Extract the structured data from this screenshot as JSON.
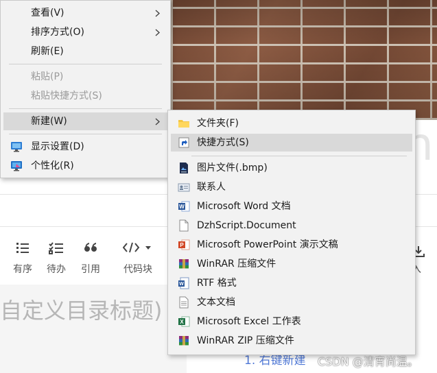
{
  "main_menu": {
    "items": [
      {
        "label": "查看(V)"
      },
      {
        "label": "排序方式(O)"
      },
      {
        "label": "刷新(E)"
      },
      {
        "label": "粘贴(P)"
      },
      {
        "label": "粘贴快捷方式(S)"
      },
      {
        "label": "新建(W)"
      },
      {
        "label": "显示设置(D)",
        "icon": "display-settings-icon"
      },
      {
        "label": "个性化(R)",
        "icon": "personalize-icon"
      }
    ]
  },
  "new_submenu": {
    "items": [
      {
        "label": "文件夹(F)",
        "icon": "folder-icon"
      },
      {
        "label": "快捷方式(S)",
        "icon": "shortcut-icon"
      },
      {
        "label": "图片文件(.bmp)",
        "icon": "bmp-image-icon"
      },
      {
        "label": "联系人",
        "icon": "contact-card-icon"
      },
      {
        "label": "Microsoft Word 文档",
        "icon": "word-icon"
      },
      {
        "label": "DzhScript.Document",
        "icon": "blank-document-icon"
      },
      {
        "label": "Microsoft PowerPoint 演示文稿",
        "icon": "powerpoint-icon"
      },
      {
        "label": "WinRAR 压缩文件",
        "icon": "winrar-icon"
      },
      {
        "label": "RTF 格式",
        "icon": "rtf-icon"
      },
      {
        "label": "文本文档",
        "icon": "text-document-icon"
      },
      {
        "label": "Microsoft Excel 工作表",
        "icon": "excel-icon"
      },
      {
        "label": "WinRAR ZIP 压缩文件",
        "icon": "winrar-zip-icon"
      }
    ]
  },
  "editor": {
    "bg_char": "n",
    "toolbar": {
      "ordered_label": "有序",
      "todo_label": "待办",
      "quote_label": "引用",
      "code_label": "代码块",
      "import_tail": "入"
    },
    "heading_placeholder": "自定义目录标题)",
    "list_line": "1. 右键新建"
  },
  "watermark": "CSDN @清宵尚温。",
  "colors": {
    "menu_bg": "#f2f2f2",
    "menu_highlight": "#d9d9d9",
    "disabled_text": "#9a9a9a",
    "link_blue": "#4f78d6"
  }
}
